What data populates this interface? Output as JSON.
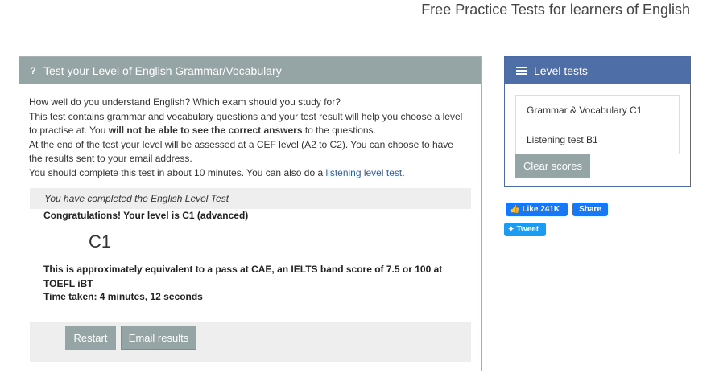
{
  "header": {
    "site_title": "Free Practice Tests for learners of English"
  },
  "main_panel": {
    "icon": "question-icon",
    "title": "Test your Level of English Grammar/Vocabulary",
    "intro": {
      "line1": "How well do you understand English? Which exam should you study for?",
      "line2_pre": "This test contains grammar and vocabulary questions and your test result will help you choose a level to practise at. You ",
      "line2_bold": "will not be able to see the correct answers",
      "line2_post": " to the questions.",
      "line3": "At the end of the test your level will be assessed at a CEF level (A2 to C2). You can choose to have the results sent to your email address.",
      "line4_pre": "You should complete this test in about 10 minutes. You can also do a ",
      "line4_link": "listening level test",
      "line4_post": "."
    },
    "result": {
      "completed_text": "You have completed the English Level Test",
      "congrats_text": "Congratulations! Your level is C1 (advanced)",
      "level": "C1",
      "equivalence": "This is approximately equivalent to a pass at CAE, an IELTS band score of 7.5 or 100 at TOEFL iBT",
      "time_taken": "Time taken: 4 minutes, 12 seconds"
    },
    "buttons": {
      "restart": "Restart",
      "email": "Email results"
    }
  },
  "side_panel": {
    "icon": "list-icon",
    "title": "Level tests",
    "items": [
      {
        "label": "Grammar & Vocabulary C1"
      },
      {
        "label": "Listening test B1"
      }
    ],
    "clear_button": "Clear scores"
  },
  "social": {
    "like_label": "Like 241K",
    "share_label": "Share",
    "tweet_label": "Tweet"
  },
  "colors": {
    "main_accent": "#95a4a4",
    "side_accent": "#4e6ea8",
    "facebook": "#1877f2",
    "twitter": "#1d9bf0"
  }
}
